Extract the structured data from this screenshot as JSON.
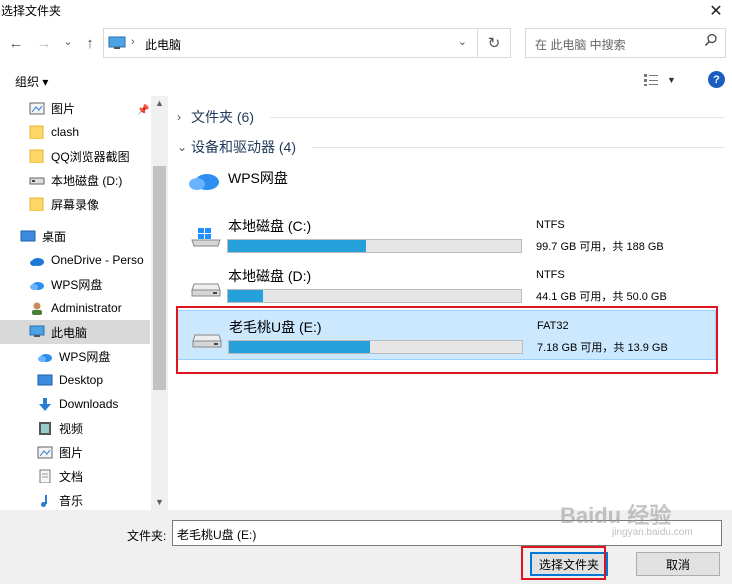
{
  "window": {
    "title": "选择文件夹",
    "close_glyph": "✕"
  },
  "nav": {
    "back_glyph": "←",
    "forward_glyph": "→",
    "recent_glyph": "⌄",
    "up_glyph": "↑",
    "address": "此电脑",
    "refresh_glyph": "↻",
    "search_placeholder": "在 此电脑 中搜索"
  },
  "commandbar": {
    "organize_label": "组织 ▾",
    "help_label": "?"
  },
  "sidebar": {
    "items": [
      {
        "label": "图片",
        "icon": "pictures-icon"
      },
      {
        "label": "clash",
        "icon": "folder-icon"
      },
      {
        "label": "QQ浏览器截图",
        "icon": "folder-icon"
      },
      {
        "label": "本地磁盘 (D:)",
        "icon": "drive-icon"
      },
      {
        "label": "屏幕录像",
        "icon": "folder-icon"
      },
      {
        "label": "桌面",
        "icon": "desktop-icon"
      },
      {
        "label": "OneDrive - Perso",
        "icon": "onedrive-icon"
      },
      {
        "label": "WPS网盘",
        "icon": "wps-cloud-icon"
      },
      {
        "label": "Administrator",
        "icon": "user-icon"
      },
      {
        "label": "此电脑",
        "icon": "computer-icon"
      },
      {
        "label": "WPS网盘",
        "icon": "wps-cloud-icon"
      },
      {
        "label": "Desktop",
        "icon": "desktop-folder-icon"
      },
      {
        "label": "Downloads",
        "icon": "downloads-icon"
      },
      {
        "label": "视频",
        "icon": "videos-icon"
      },
      {
        "label": "图片",
        "icon": "pictures-icon"
      },
      {
        "label": "文档",
        "icon": "documents-icon"
      },
      {
        "label": "音乐",
        "icon": "music-icon"
      }
    ]
  },
  "main": {
    "folders_group": "文件夹 (6)",
    "devices_group": "设备和驱动器 (4)",
    "wps_drive": "WPS网盘",
    "drives": [
      {
        "name": "本地磁盘 (C:)",
        "fs": "NTFS",
        "space": "99.7 GB 可用，共 188 GB",
        "used_fraction": 0.47
      },
      {
        "name": "本地磁盘 (D:)",
        "fs": "NTFS",
        "space": "44.1 GB 可用，共 50.0 GB",
        "used_fraction": 0.12
      },
      {
        "name": "老毛桃U盘 (E:)",
        "fs": "FAT32",
        "space": "7.18 GB 可用，共 13.9 GB",
        "used_fraction": 0.48
      }
    ]
  },
  "bottom": {
    "folder_label": "文件夹:",
    "folder_value": "老毛桃U盘 (E:)",
    "select_label": "选择文件夹",
    "cancel_label": "取消"
  },
  "watermark": {
    "text": "Baidu 经验",
    "sub": "jingyan.baidu.com"
  },
  "colors": {
    "accent": "#26a0da",
    "selection": "#cce8ff",
    "highlight_box": "#e0141e"
  }
}
